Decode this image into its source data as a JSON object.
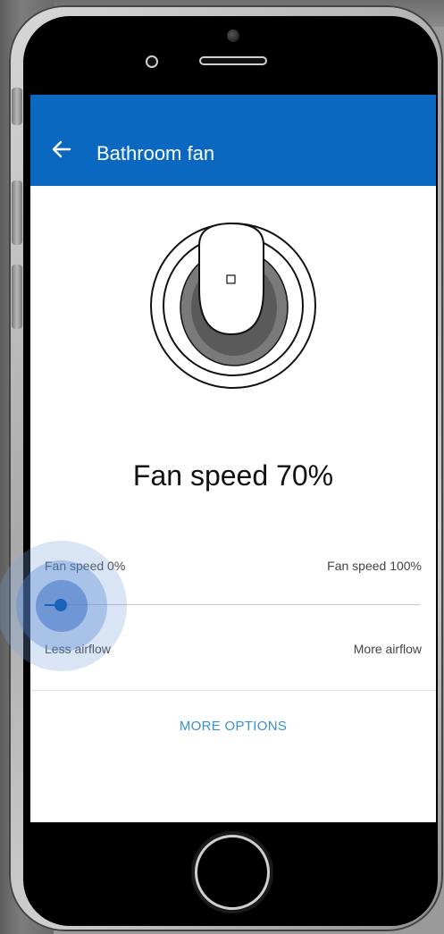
{
  "app_bar": {
    "title": "Bathroom fan",
    "color": "#0a68c0"
  },
  "fan": {
    "speed_text": "Fan speed 70%",
    "speed_value_percent": 70
  },
  "slider": {
    "min_label": "Fan speed 0%",
    "max_label": "Fan speed 100%",
    "left_caption": "Less airflow",
    "right_caption": "More airflow",
    "accent_color": "#1a63b8"
  },
  "actions": {
    "more_options": "MORE OPTIONS",
    "link_color": "#3a8fd0"
  },
  "icons": {
    "back": "arrow-left-icon",
    "fan": "fan-knob-icon"
  }
}
